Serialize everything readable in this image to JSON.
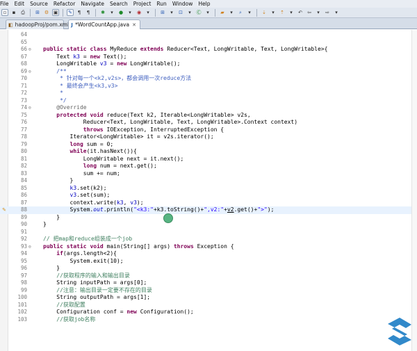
{
  "menu": [
    "File",
    "Edit",
    "Source",
    "Refactor",
    "Navigate",
    "Search",
    "Project",
    "Run",
    "Window",
    "Help"
  ],
  "tabs": [
    {
      "label": "hadoopProj/pom.xml",
      "icon": "xml-file-icon"
    },
    {
      "label": "*WordCountApp.java",
      "icon": "java-file-icon",
      "close": "✕"
    }
  ],
  "toolbar_icons": [
    "new-icon",
    "save-icon",
    "print-icon",
    "debug-icon",
    "run-icon",
    "external-tools-icon",
    "new-project-icon",
    "new-package-icon",
    "new-class-icon",
    "open-type-icon",
    "search-icon",
    "back-icon",
    "forward-icon"
  ],
  "editor": {
    "lines": [
      {
        "n": "64",
        "fold": "",
        "mark": "",
        "code": []
      },
      {
        "n": "65",
        "fold": "",
        "mark": "",
        "code": []
      },
      {
        "n": "66",
        "fold": "⊖",
        "mark": "",
        "code": [
          [
            "kw",
            "public "
          ],
          [
            "kw",
            "static "
          ],
          [
            "kw",
            "class "
          ],
          [
            "",
            "MyReduce "
          ],
          [
            "kw",
            "extends "
          ],
          [
            "",
            "Reducer<Text, LongWritable, Text, LongWritable>{"
          ]
        ]
      },
      {
        "n": "67",
        "fold": "",
        "mark": "",
        "code": [
          [
            "",
            "    Text "
          ],
          [
            "fld",
            "k3"
          ],
          [
            "",
            " = "
          ],
          [
            "kw",
            "new "
          ],
          [
            "",
            "Text();"
          ]
        ]
      },
      {
        "n": "68",
        "fold": "",
        "mark": "",
        "code": [
          [
            "",
            "    LongWritable "
          ],
          [
            "fld",
            "v3"
          ],
          [
            "",
            " = "
          ],
          [
            "kw",
            "new "
          ],
          [
            "",
            "LongWritable();"
          ]
        ]
      },
      {
        "n": "69",
        "fold": "⊖",
        "mark": "",
        "code": [
          [
            "cn",
            "    /**"
          ]
        ]
      },
      {
        "n": "70",
        "fold": "",
        "mark": "",
        "code": [
          [
            "cn",
            "     * 针对每一个<k2,v2s>，都会调用一次reduce方法"
          ]
        ]
      },
      {
        "n": "71",
        "fold": "",
        "mark": "",
        "code": [
          [
            "cn",
            "     * 最终会产生<k3,v3>"
          ]
        ]
      },
      {
        "n": "72",
        "fold": "",
        "mark": "",
        "code": [
          [
            "cn",
            "     *"
          ]
        ]
      },
      {
        "n": "73",
        "fold": "",
        "mark": "",
        "code": [
          [
            "cn",
            "     */"
          ]
        ]
      },
      {
        "n": "74",
        "fold": "⊖",
        "mark": "",
        "code": [
          [
            "an",
            "    @Override"
          ]
        ]
      },
      {
        "n": "75",
        "fold": "",
        "mark": "",
        "code": [
          [
            "kw",
            "    protected "
          ],
          [
            "kw",
            "void "
          ],
          [
            "",
            "reduce(Text k2, Iterable<LongWritable> v2s,"
          ]
        ]
      },
      {
        "n": "76",
        "fold": "",
        "mark": "",
        "code": [
          [
            "",
            "            Reducer<Text, LongWritable, Text, LongWritable>.Context context)"
          ]
        ]
      },
      {
        "n": "77",
        "fold": "",
        "mark": "",
        "code": [
          [
            "kw",
            "            throws "
          ],
          [
            "",
            "IOException, InterruptedException {"
          ]
        ]
      },
      {
        "n": "78",
        "fold": "",
        "mark": "",
        "code": [
          [
            "",
            "        Iterator<LongWritable> it = v2s.iterator();"
          ]
        ]
      },
      {
        "n": "79",
        "fold": "",
        "mark": "",
        "code": [
          [
            "kw",
            "        long "
          ],
          [
            "",
            "sum = 0;"
          ]
        ]
      },
      {
        "n": "80",
        "fold": "",
        "mark": "",
        "code": [
          [
            "kw",
            "        while"
          ],
          [
            "",
            "(it.hasNext()){"
          ]
        ]
      },
      {
        "n": "81",
        "fold": "",
        "mark": "",
        "code": [
          [
            "",
            "            LongWritable next = it.next();"
          ]
        ]
      },
      {
        "n": "82",
        "fold": "",
        "mark": "",
        "code": [
          [
            "kw",
            "            long "
          ],
          [
            "",
            "num = next.get();"
          ]
        ]
      },
      {
        "n": "83",
        "fold": "",
        "mark": "",
        "code": [
          [
            "",
            "            sum += num;"
          ]
        ]
      },
      {
        "n": "84",
        "fold": "",
        "mark": "",
        "code": [
          [
            "",
            "        }"
          ]
        ]
      },
      {
        "n": "85",
        "fold": "",
        "mark": "",
        "code": [
          [
            "",
            "        "
          ],
          [
            "fld",
            "k3"
          ],
          [
            "",
            ".set(k2);"
          ]
        ]
      },
      {
        "n": "86",
        "fold": "",
        "mark": "",
        "code": [
          [
            "",
            "        "
          ],
          [
            "fld",
            "v3"
          ],
          [
            "",
            ".set(sum);"
          ]
        ]
      },
      {
        "n": "87",
        "fold": "",
        "mark": "",
        "code": [
          [
            "",
            "        context.write("
          ],
          [
            "fld",
            "k3"
          ],
          [
            "",
            ", "
          ],
          [
            "fld",
            "v3"
          ],
          [
            "",
            ");"
          ]
        ]
      },
      {
        "n": "88",
        "fold": "",
        "mark": "✎",
        "current": true,
        "code": [
          [
            "",
            "        System."
          ],
          [
            "fld it",
            "out"
          ],
          [
            "",
            ".println("
          ],
          [
            "str",
            "\"<k3:\""
          ],
          [
            "",
            "+k3.toString()+"
          ],
          [
            "str",
            "\",v2:\""
          ],
          [
            "",
            "+"
          ],
          [
            "ul",
            "v2"
          ],
          [
            "",
            ".get()+"
          ],
          [
            "str",
            "\">\""
          ],
          [
            "",
            ");"
          ]
        ]
      },
      {
        "n": "89",
        "fold": "",
        "mark": "",
        "code": [
          [
            "",
            "    }"
          ]
        ]
      },
      {
        "n": "90",
        "fold": "",
        "mark": "",
        "code": [
          [
            "",
            "}"
          ]
        ]
      },
      {
        "n": "91",
        "fold": "",
        "mark": "",
        "code": []
      },
      {
        "n": "92",
        "fold": "",
        "mark": "",
        "code": [
          [
            "cm",
            "// 把map和reduce组装成一个job"
          ]
        ]
      },
      {
        "n": "93",
        "fold": "⊖",
        "mark": "",
        "code": [
          [
            "kw",
            "public "
          ],
          [
            "kw",
            "static "
          ],
          [
            "kw",
            "void "
          ],
          [
            "",
            "main(String[] args) "
          ],
          [
            "kw",
            "throws "
          ],
          [
            "",
            "Exception {"
          ]
        ]
      },
      {
        "n": "94",
        "fold": "",
        "mark": "",
        "code": [
          [
            "kw",
            "    if"
          ],
          [
            "",
            "(args.length<2){"
          ]
        ]
      },
      {
        "n": "95",
        "fold": "",
        "mark": "",
        "code": [
          [
            "",
            "        System.exit(10);"
          ]
        ]
      },
      {
        "n": "96",
        "fold": "",
        "mark": "",
        "code": [
          [
            "",
            "    }"
          ]
        ]
      },
      {
        "n": "97",
        "fold": "",
        "mark": "",
        "code": [
          [
            "cm",
            "    //获取程序的输入和输出目录"
          ]
        ]
      },
      {
        "n": "98",
        "fold": "",
        "mark": "",
        "code": [
          [
            "",
            "    String inputPath = args[0];"
          ]
        ]
      },
      {
        "n": "99",
        "fold": "",
        "mark": "",
        "code": [
          [
            "cm",
            "    //注意：输出目录一定要不存在的目录"
          ]
        ]
      },
      {
        "n": "100",
        "fold": "",
        "mark": "",
        "code": [
          [
            "",
            "    String outputPath = args[1];"
          ]
        ]
      },
      {
        "n": "101",
        "fold": "",
        "mark": "",
        "code": [
          [
            "cm",
            "    //获取配置"
          ]
        ]
      },
      {
        "n": "102",
        "fold": "",
        "mark": "",
        "code": [
          [
            "",
            "    Configuration conf = "
          ],
          [
            "kw",
            "new "
          ],
          [
            "",
            "Configuration();"
          ]
        ]
      },
      {
        "n": "103",
        "fold": "",
        "mark": "",
        "code": [
          [
            "cm",
            "    //获取job名称"
          ]
        ]
      }
    ]
  },
  "colors": {
    "keyword": "#7f0055",
    "field": "#0000c0",
    "comment": "#3f7f5f",
    "javadoc": "#3f5fbf",
    "string": "#2a00ff",
    "annotation": "#646464",
    "current_line": "#e8f2fe"
  }
}
